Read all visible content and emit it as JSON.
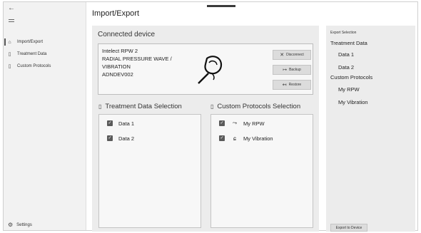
{
  "nav": {
    "back_icon": "arrow-left-icon",
    "menu_icon": "hamburger-icon",
    "items": [
      {
        "label": "Import/Export",
        "icon": "home-icon",
        "active": true
      },
      {
        "label": "Treatment Data",
        "icon": "document-icon",
        "active": false
      },
      {
        "label": "Custom Protocols",
        "icon": "protocol-icon",
        "active": false
      }
    ],
    "settings_label": "Settings"
  },
  "header": {
    "title": "Import/Export"
  },
  "device": {
    "section_title": "Connected device",
    "lines": [
      "Intelect RPW 2",
      "RADIAL PRESSURE WAVE /",
      "VIBRATION",
      "ADNDEV002"
    ],
    "buttons": {
      "disconnect": "Disconnect",
      "backup": "Backup",
      "restore": "Restore"
    }
  },
  "treatment_selection": {
    "title": "Treatment Data Selection",
    "items": [
      {
        "label": "Data 1",
        "checked": true
      },
      {
        "label": "Data 2",
        "checked": true
      }
    ]
  },
  "protocols_selection": {
    "title": "Custom Protocols Selection",
    "items": [
      {
        "label": "My RPW",
        "checked": true,
        "icon": "rpw-applicator-icon"
      },
      {
        "label": "My Vibration",
        "checked": true,
        "icon": "vibration-applicator-icon"
      }
    ]
  },
  "export_selection": {
    "caption": "Export Selection",
    "treatment_heading": "Treatment Data",
    "treatment_items": [
      "Data 1",
      "Data 2"
    ],
    "protocols_heading": "Custom Protocols",
    "protocol_items": [
      "My RPW",
      "My Vibration"
    ],
    "export_button": "Export to Device"
  }
}
